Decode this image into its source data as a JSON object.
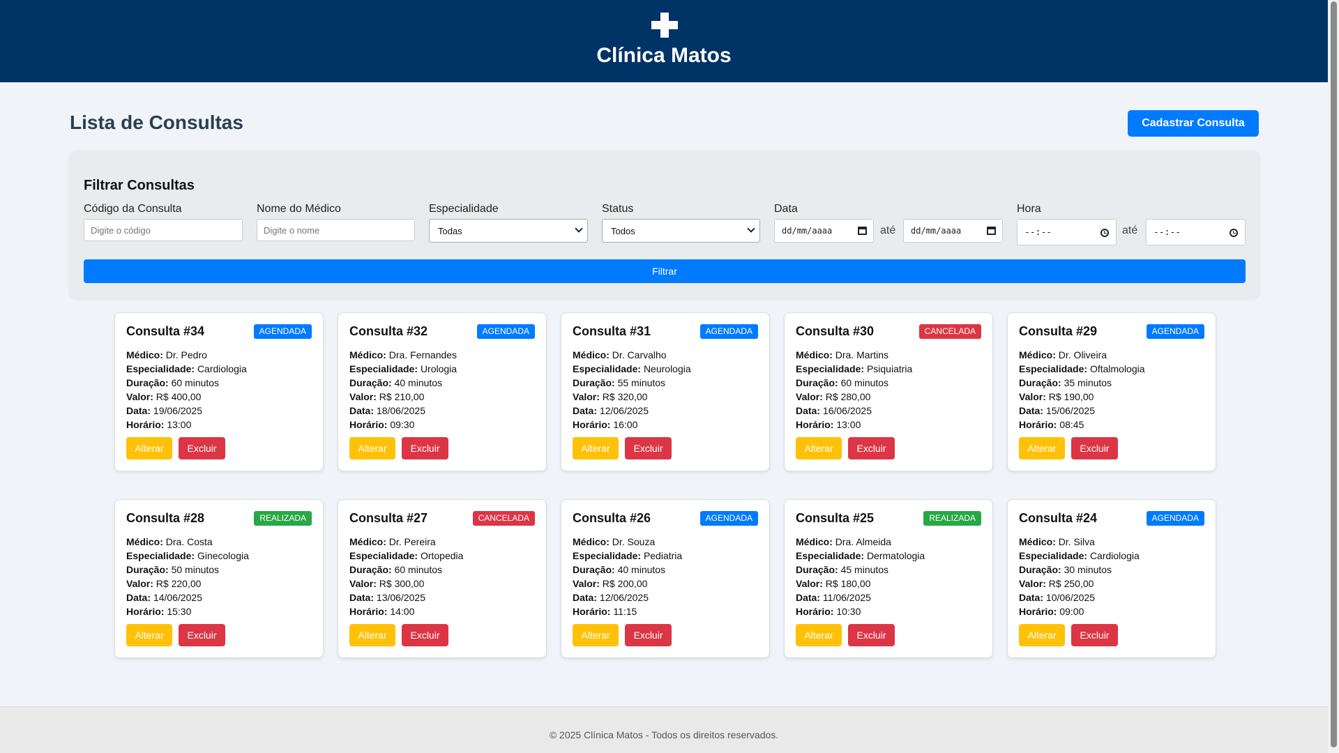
{
  "header": {
    "title": "Clínica Matos",
    "logo_icon": "medical-cross-icon"
  },
  "main": {
    "title": "Lista de Consultas",
    "add_button": "Cadastrar Consulta"
  },
  "filters": {
    "title": "Filtrar Consultas",
    "codigo": {
      "label": "Código da Consulta",
      "placeholder": "Digite o código"
    },
    "medico": {
      "label": "Nome do Médico",
      "placeholder": "Digite o nome"
    },
    "especialidade": {
      "label": "Especialidade",
      "value": "Todas"
    },
    "status": {
      "label": "Status",
      "value": "Todos"
    },
    "data": {
      "label": "Data",
      "from": "dd/mm/aaaa",
      "sep": "até",
      "to": "dd/mm/aaaa"
    },
    "hora": {
      "label": "Hora",
      "from": "--:--",
      "sep": "até",
      "to": "--:--"
    },
    "submit": "Filtrar"
  },
  "labels": {
    "medico": "Médico:",
    "especialidade": "Especialidade:",
    "duracao": "Duração:",
    "valor": "Valor:",
    "data": "Data:",
    "horario": "Horário:",
    "alterar": "Alterar",
    "excluir": "Excluir"
  },
  "status_colors": {
    "AGENDADA": "#007bff",
    "CANCELADA": "#dc3545",
    "REALIZADA": "#28a745"
  },
  "consultas": [
    {
      "title": "Consulta #34",
      "status": "AGENDADA",
      "medico": "Dr. Pedro",
      "especialidade": "Cardiologia",
      "duracao": "60 minutos",
      "valor": "R$ 400,00",
      "data": "19/06/2025",
      "horario": "13:00"
    },
    {
      "title": "Consulta #32",
      "status": "AGENDADA",
      "medico": "Dra. Fernandes",
      "especialidade": "Urologia",
      "duracao": "40 minutos",
      "valor": "R$ 210,00",
      "data": "18/06/2025",
      "horario": "09:30"
    },
    {
      "title": "Consulta #31",
      "status": "AGENDADA",
      "medico": "Dr. Carvalho",
      "especialidade": "Neurologia",
      "duracao": "55 minutos",
      "valor": "R$ 320,00",
      "data": "12/06/2025",
      "horario": "16:00"
    },
    {
      "title": "Consulta #30",
      "status": "CANCELADA",
      "medico": "Dra. Martins",
      "especialidade": "Psiquiatria",
      "duracao": "60 minutos",
      "valor": "R$ 280,00",
      "data": "16/06/2025",
      "horario": "13:00"
    },
    {
      "title": "Consulta #29",
      "status": "AGENDADA",
      "medico": "Dr. Oliveira",
      "especialidade": "Oftalmologia",
      "duracao": "35 minutos",
      "valor": "R$ 190,00",
      "data": "15/06/2025",
      "horario": "08:45"
    },
    {
      "title": "Consulta #28",
      "status": "REALIZADA",
      "medico": "Dra. Costa",
      "especialidade": "Ginecologia",
      "duracao": "50 minutos",
      "valor": "R$ 220,00",
      "data": "14/06/2025",
      "horario": "15:30"
    },
    {
      "title": "Consulta #27",
      "status": "CANCELADA",
      "medico": "Dr. Pereira",
      "especialidade": "Ortopedia",
      "duracao": "60 minutos",
      "valor": "R$ 300,00",
      "data": "13/06/2025",
      "horario": "14:00"
    },
    {
      "title": "Consulta #26",
      "status": "AGENDADA",
      "medico": "Dr. Souza",
      "especialidade": "Pediatria",
      "duracao": "40 minutos",
      "valor": "R$ 200,00",
      "data": "12/06/2025",
      "horario": "11:15"
    },
    {
      "title": "Consulta #25",
      "status": "REALIZADA",
      "medico": "Dra. Almeida",
      "especialidade": "Dermatologia",
      "duracao": "45 minutos",
      "valor": "R$ 180,00",
      "data": "11/06/2025",
      "horario": "10:30"
    },
    {
      "title": "Consulta #24",
      "status": "AGENDADA",
      "medico": "Dr. Silva",
      "especialidade": "Cardiologia",
      "duracao": "30 minutos",
      "valor": "R$ 250,00",
      "data": "10/06/2025",
      "horario": "09:00"
    }
  ],
  "footer": {
    "text": "© 2025 Clínica Matos - Todos os direitos reservados."
  }
}
